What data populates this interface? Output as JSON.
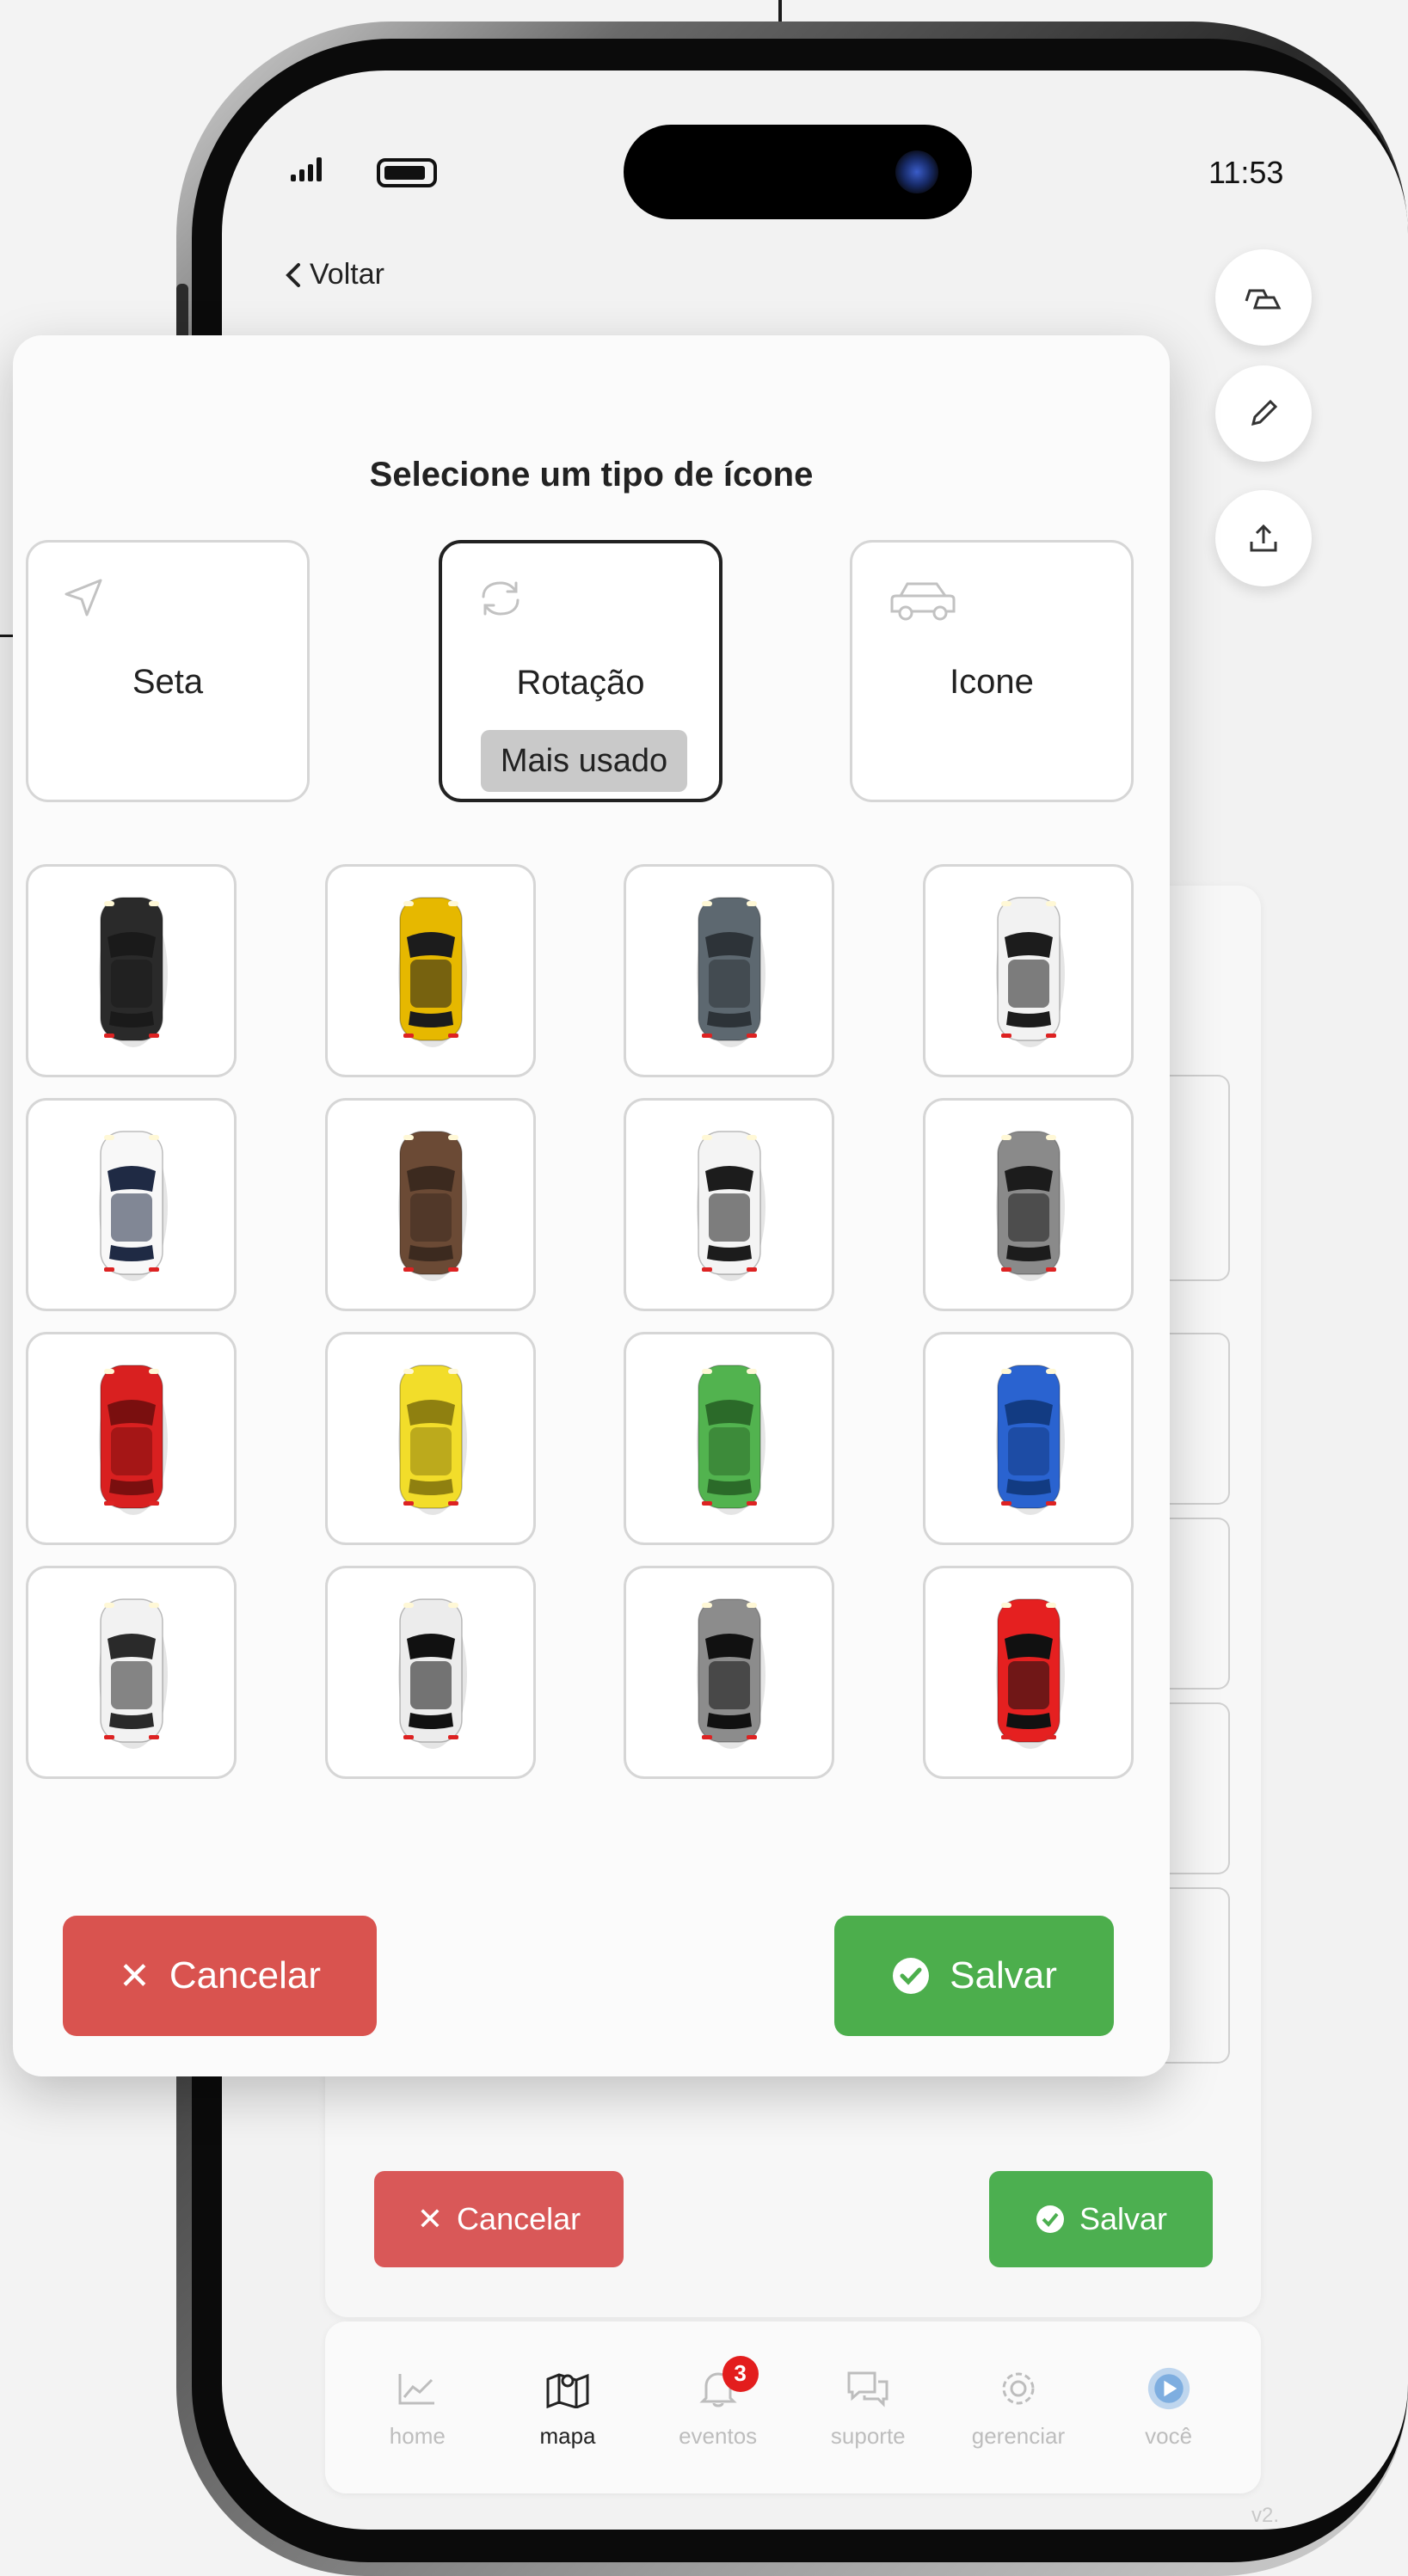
{
  "status_bar": {
    "time": "11:53"
  },
  "header": {
    "back_label": "Voltar"
  },
  "modal": {
    "title": "Selecione um tipo de ícone",
    "types": [
      {
        "label": "Seta",
        "icon": "arrow-icon",
        "selected": false
      },
      {
        "label": "Rotação",
        "icon": "rotate-icon",
        "selected": true,
        "badge": "Mais usado"
      },
      {
        "label": "Icone",
        "icon": "car-outline-icon",
        "selected": false
      }
    ],
    "cars": [
      {
        "color": "#2a2a2a",
        "roof": "#1a1a1a",
        "name": "black-convertible"
      },
      {
        "color": "#e6b800",
        "roof": "#1c1c1c",
        "name": "yellow-sportscar"
      },
      {
        "color": "#5d6870",
        "roof": "#2d3338",
        "name": "grey-sportscar"
      },
      {
        "color": "#f2f2f2",
        "roof": "#1c1c1c",
        "name": "white-convertible"
      },
      {
        "color": "#f8f8f8",
        "roof": "#1f2a44",
        "name": "taxi"
      },
      {
        "color": "#6b4a35",
        "roof": "#3c2a1f",
        "name": "brown-sedan"
      },
      {
        "color": "#f4f4f4",
        "roof": "#1c1c1c",
        "name": "white-hatchback"
      },
      {
        "color": "#8a8a8a",
        "roof": "#1c1c1c",
        "name": "grey-hatchback"
      },
      {
        "color": "#d92020",
        "roof": "#7a0f0f",
        "name": "red-car"
      },
      {
        "color": "#f2dd2a",
        "roof": "#8f8010",
        "name": "yellow-car"
      },
      {
        "color": "#52b34f",
        "roof": "#2b6a29",
        "name": "green-car"
      },
      {
        "color": "#2a63d0",
        "roof": "#123b82",
        "name": "blue-car"
      },
      {
        "color": "#f2f2f2",
        "roof": "#2a2a2a",
        "name": "white-sedan"
      },
      {
        "color": "#ececec",
        "roof": "#111111",
        "name": "white-black-roof-car"
      },
      {
        "color": "#8c8c8c",
        "roof": "#111111",
        "name": "grey-sedan"
      },
      {
        "color": "#e52020",
        "roof": "#111111",
        "name": "red-sedan"
      }
    ],
    "cancel_label": "Cancelar",
    "save_label": "Salvar"
  },
  "background_form": {
    "cancel_label": "Cancelar",
    "save_label": "Salvar"
  },
  "bottom_nav": {
    "items": [
      {
        "label": "home",
        "icon": "chart-icon",
        "active": false
      },
      {
        "label": "mapa",
        "icon": "map-icon",
        "active": true
      },
      {
        "label": "eventos",
        "icon": "bell-icon",
        "active": false,
        "badge": "3"
      },
      {
        "label": "suporte",
        "icon": "support-icon",
        "active": false
      },
      {
        "label": "gerenciar",
        "icon": "gear-icon",
        "active": false
      },
      {
        "label": "você",
        "icon": "play-avatar-icon",
        "active": false
      }
    ]
  },
  "colors": {
    "danger": "#d9534f",
    "success": "#4cae4c",
    "badge": "#e31d1d"
  }
}
